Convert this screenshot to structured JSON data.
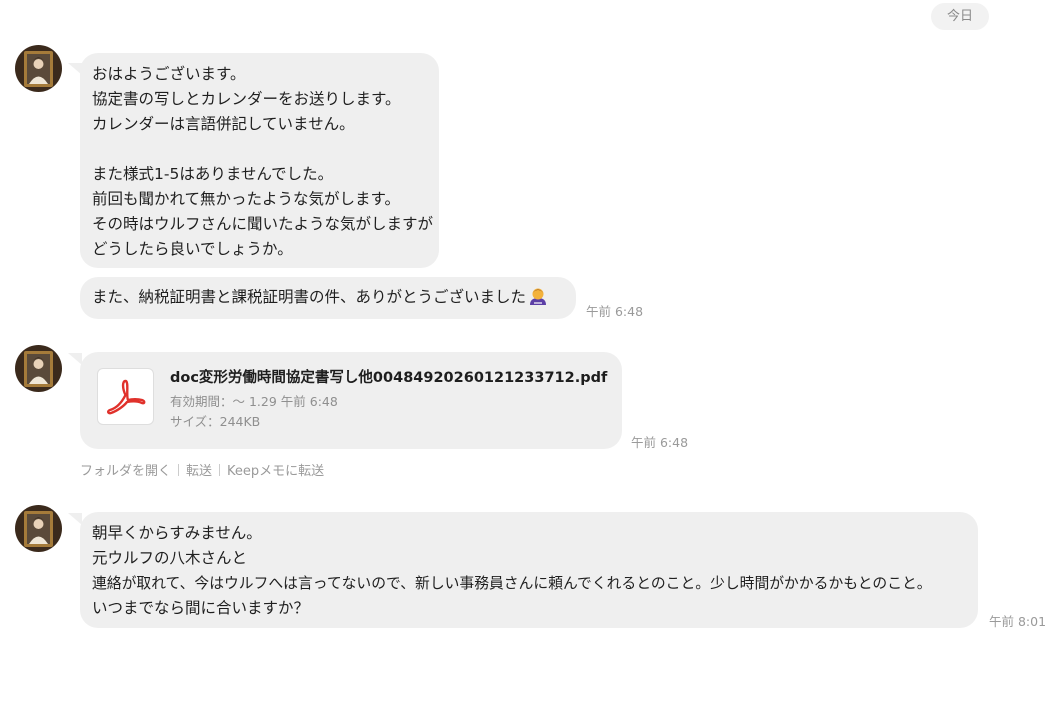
{
  "date_divider": "今日",
  "messages": [
    {
      "lines": [
        "おはようございます。",
        "協定書の写しとカレンダーをお送りします。",
        "カレンダーは言語併記していません。",
        "",
        "また様式1-5はありませんでした。",
        "前回も聞かれて無かったような気がします。",
        "その時はウルフさんに聞いたような気がしますが",
        "どうしたら良いでしょうか。"
      ]
    },
    {
      "text": "また、納税証明書と課税証明書の件、ありがとうございました",
      "emoji_icon": "bowing-person-emoji-icon",
      "time": "午前 6:48"
    },
    {
      "file": {
        "icon": "pdf-icon",
        "name": "doc変形労働時間協定書写し他00484920260121233712.pdf",
        "expiry": "有効期間：〜 1.29 午前 6:48",
        "size": "サイズ：244KB"
      },
      "time": "午前 6:48",
      "actions": [
        "フォルダを開く",
        "転送",
        "Keepメモに転送"
      ]
    },
    {
      "lines": [
        "朝早くからすみません。",
        "元ウルフの八木さんと",
        "連絡が取れて、今はウルフへは言ってないので、新しい事務員さんに頼んでくれるとのこと。少し時間がかかるかもとのこと。",
        "いつまでなら間に合いますか？"
      ],
      "time": "午前 8:01"
    }
  ],
  "colors": {
    "bubble": "#efefef",
    "timestamp": "#9a9a9a",
    "pdf_red": "#e0312b"
  }
}
